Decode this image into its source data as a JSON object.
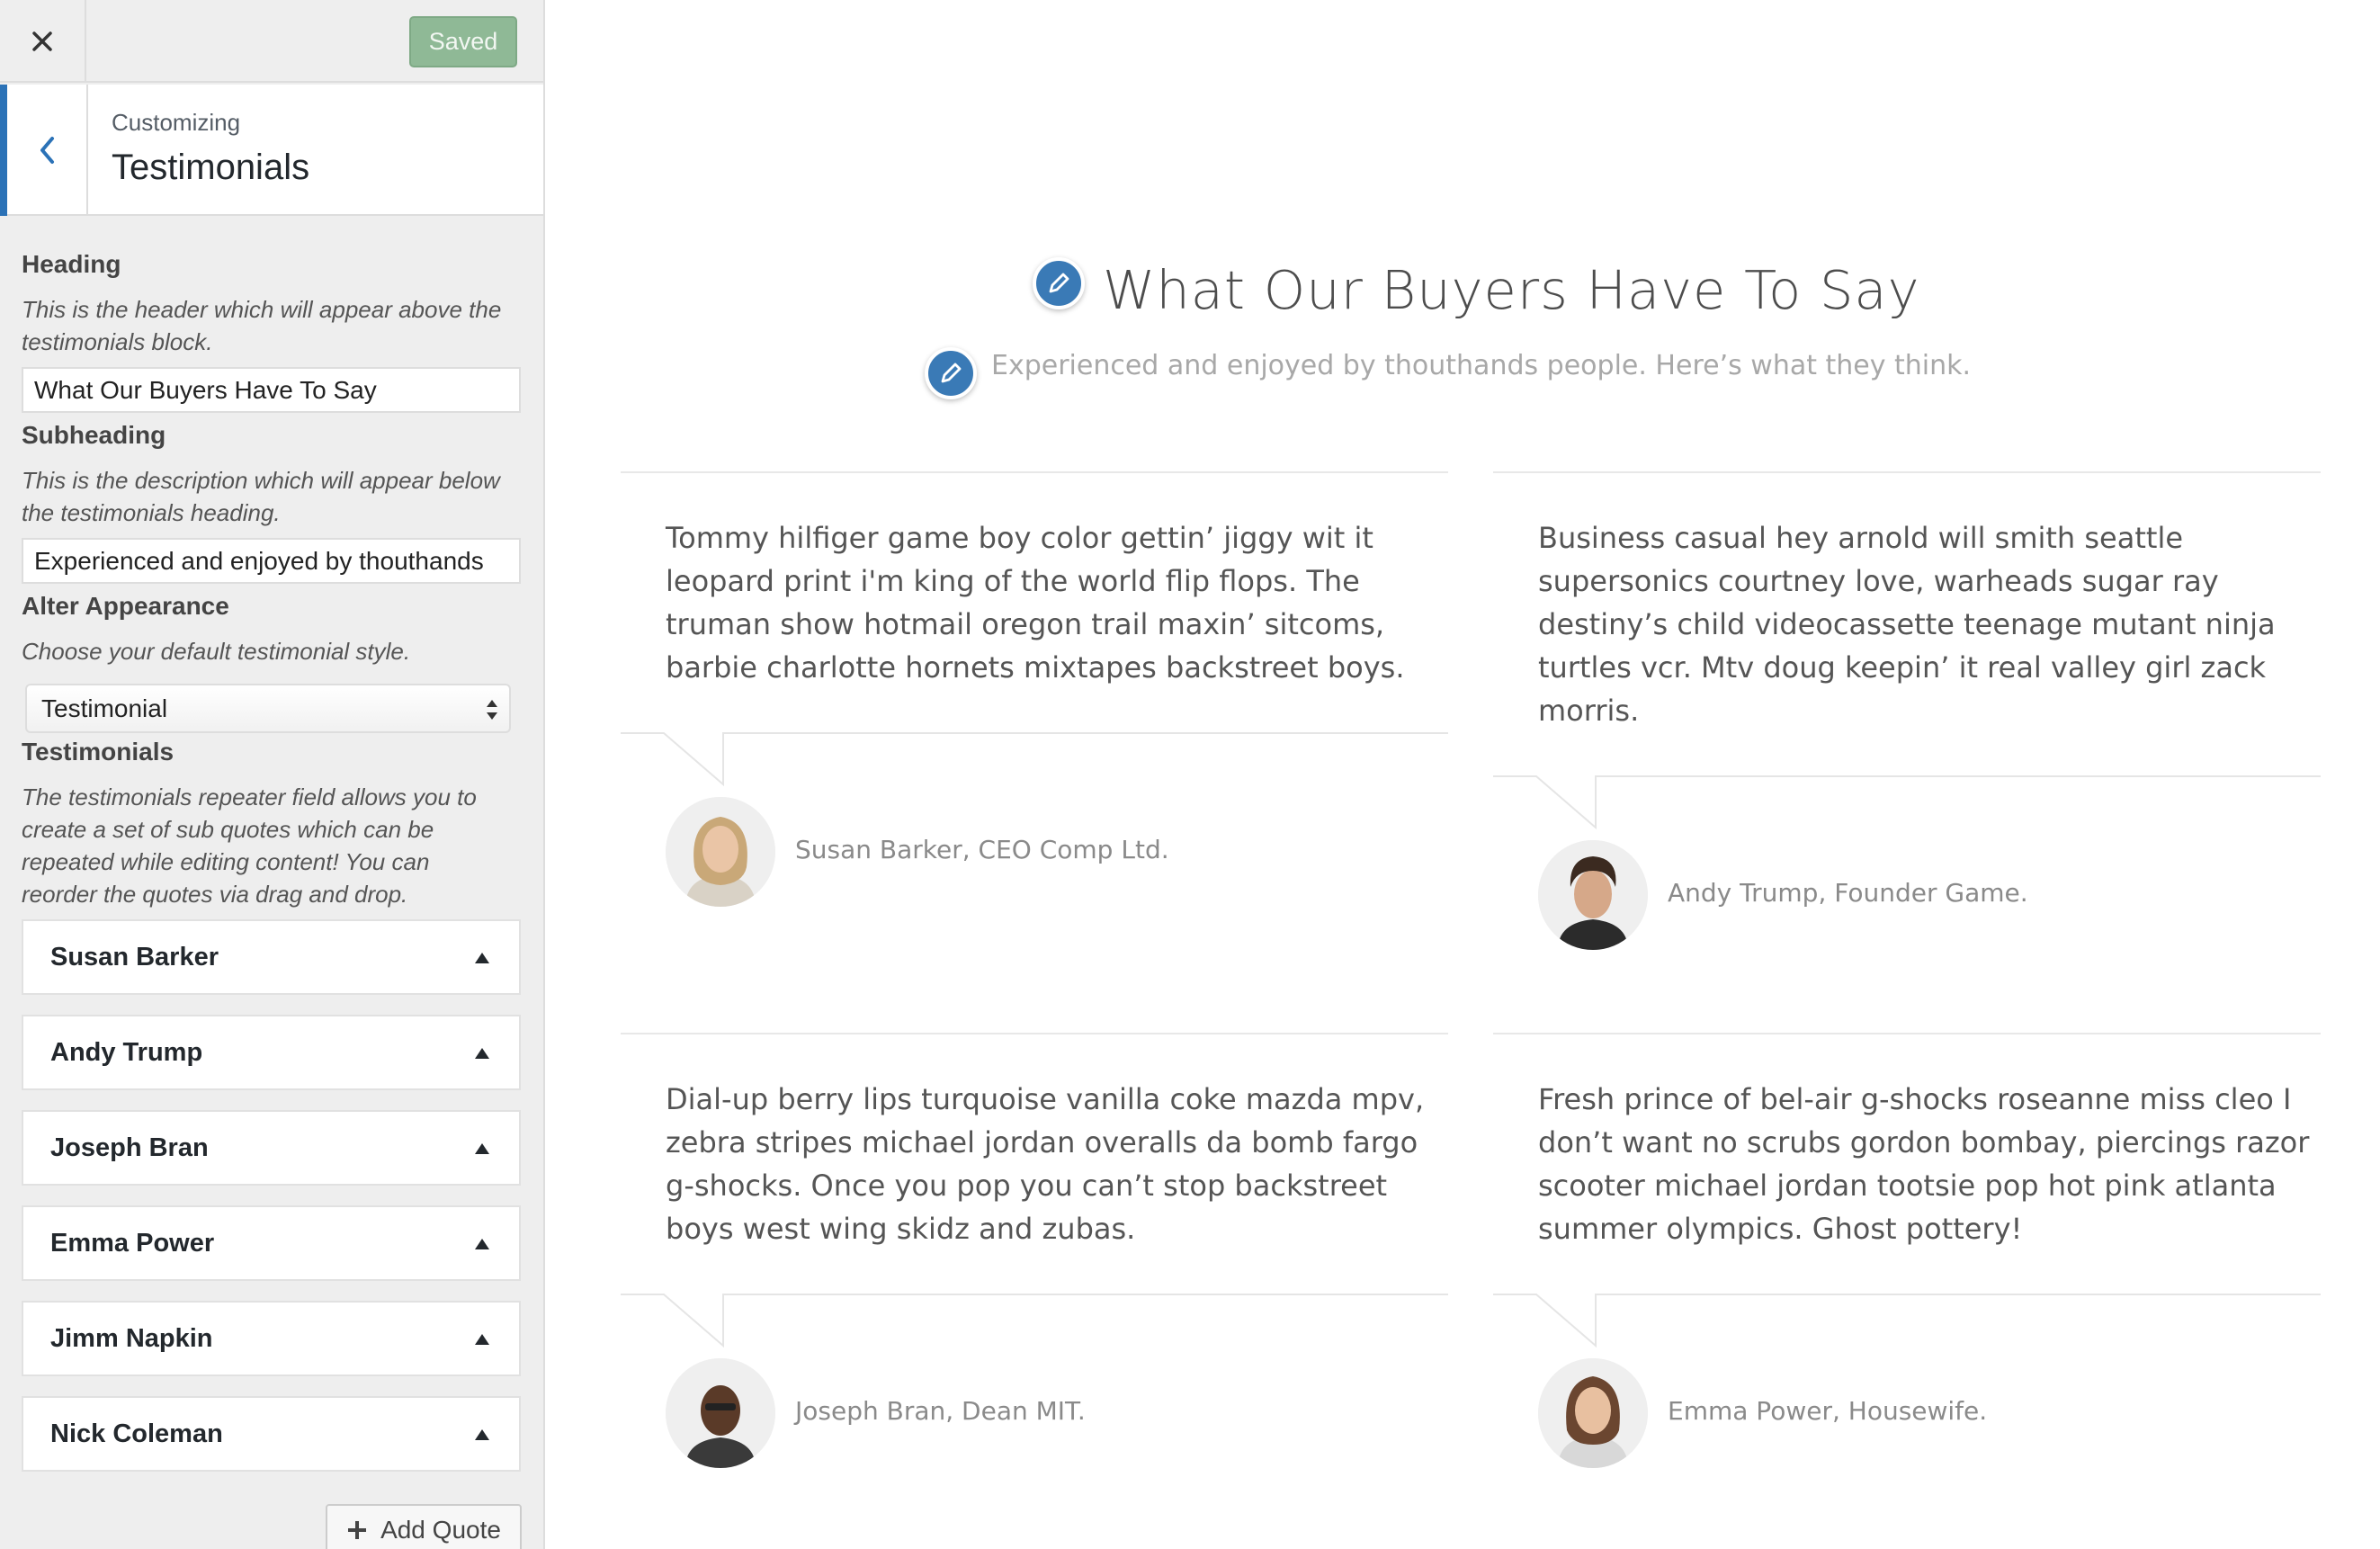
{
  "header": {
    "saved_label": "Saved"
  },
  "section": {
    "breadcrumb": "Customizing",
    "title": "Testimonials"
  },
  "controls": {
    "heading": {
      "label": "Heading",
      "description": "This is the header which will appear above the testimonials block.",
      "value": "What Our Buyers Have To Say"
    },
    "subheading": {
      "label": "Subheading",
      "description": "This is the description which will appear below the testimonials heading.",
      "value": "Experienced and enjoyed by thouthands"
    },
    "appearance": {
      "label": "Alter Appearance",
      "description": "Choose your default testimonial style.",
      "selected": "Testimonial"
    },
    "testimonials": {
      "label": "Testimonials",
      "description": "The testimonials repeater field allows you to create a set of sub quotes which can be repeated while editing content! You can reorder the quotes via drag and drop.",
      "items": [
        "Susan Barker",
        "Andy Trump",
        "Joseph Bran",
        "Emma Power",
        "Jimm Napkin",
        "Nick Coleman"
      ],
      "add_label": "Add Quote"
    }
  },
  "preview": {
    "heading": "What Our Buyers Have To Say",
    "subheading": "Experienced and enjoyed by thouthands people. Here’s what they think.",
    "cards": [
      {
        "quote": "Tommy hilfiger game boy color gettin’ jiggy wit it leopard print i'm king of the world flip flops. The truman show hotmail oregon trail maxin’ sitcoms, barbie charlotte hornets mixtapes backstreet boys.",
        "author": "Susan Barker, CEO Comp Ltd."
      },
      {
        "quote": "Business casual hey arnold will smith seattle supersonics courtney love, warheads sugar ray destiny’s child videocassette teenage mutant ninja turtles vcr. Mtv doug keepin’ it real valley girl zack morris.",
        "author": "Andy Trump, Founder Game."
      },
      {
        "quote": "Dial-up berry lips turquoise vanilla coke mazda mpv, zebra stripes michael jordan overalls da bomb fargo g-shocks. Once you pop you can’t stop backstreet boys west wing skidz and zubas.",
        "author": "Joseph Bran, Dean MIT."
      },
      {
        "quote": "Fresh prince of bel-air g-shocks roseanne miss cleo I don’t want no scrubs gordon bombay, piercings razor scooter michael jordan tootsie pop hot pink atlanta summer olympics. Ghost pottery!",
        "author": "Emma Power, Housewife."
      }
    ]
  },
  "colors": {
    "accent": "#2b72b7",
    "saved_button": "#8fb996",
    "edit_pin": "#3a7ab6"
  },
  "icons": [
    "close-icon",
    "chevron-left-icon",
    "select-arrows-icon",
    "triangle-up-icon",
    "plus-icon",
    "pencil-icon"
  ]
}
